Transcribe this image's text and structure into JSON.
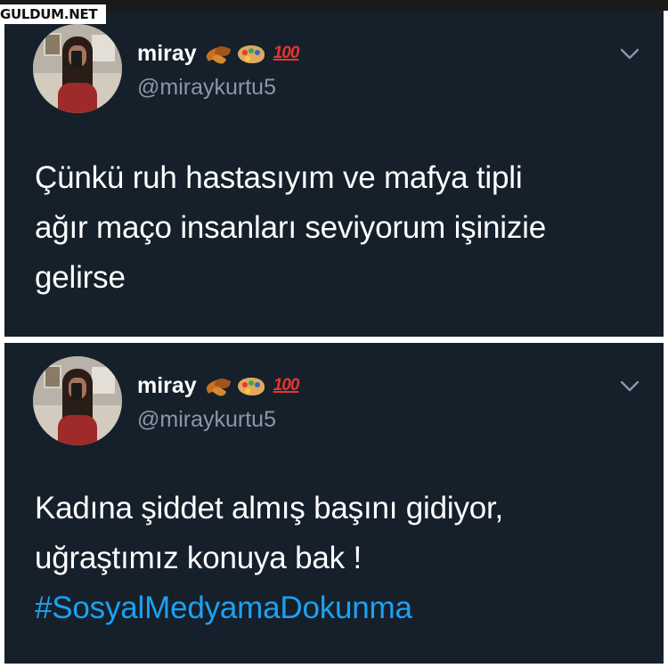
{
  "watermark": "GULDUM.NET",
  "tweets": [
    {
      "name": "miray",
      "handle": "@miraykurtu5",
      "emoji": [
        "leaves-icon",
        "palette-icon",
        "hundred-points-icon"
      ],
      "hundred": "100",
      "lines": [
        "Çünkü ruh hastasıyım ve mafya tipli",
        "ağır maço insanları seviyorum işinizie",
        "gelirse"
      ]
    },
    {
      "name": "miray",
      "handle": "@miraykurtu5",
      "emoji": [
        "leaves-icon",
        "palette-icon",
        "hundred-points-icon"
      ],
      "hundred": "100",
      "lines": [
        "Kadına şiddet almış başını gidiyor,",
        "uğraştımız konuya bak !"
      ],
      "hashtag": "#SosyalMedyamaDokunma"
    }
  ],
  "colors": {
    "background": "#15202b",
    "text": "#ffffff",
    "secondary": "#8899a6",
    "link": "#1da1f2"
  }
}
